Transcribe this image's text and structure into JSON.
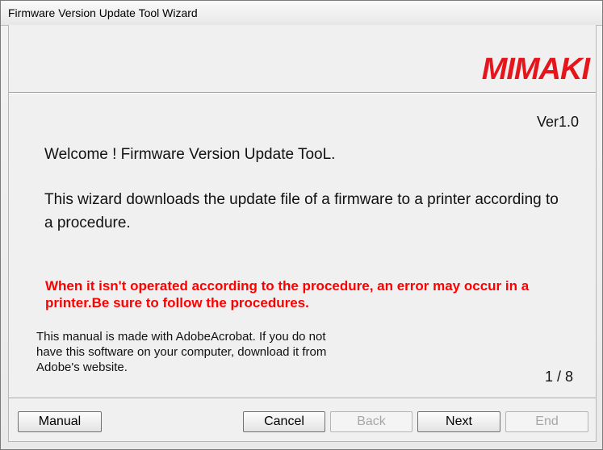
{
  "window": {
    "title": "Firmware Version Update Tool Wizard"
  },
  "brand": {
    "logo_text": "Mimaki",
    "color": "#e6141b"
  },
  "content": {
    "version": "Ver1.0",
    "welcome": "Welcome !  Firmware Version Update TooL.",
    "description": "This wizard downloads the update file of a firmware to a printer according to a procedure.",
    "warning": "When it isn't operated according to the procedure, an error may occur in a printer.Be sure to follow the procedures.",
    "warning_color": "#ff0000",
    "manual_note": "This manual is made with AdobeAcrobat. If you do not have this software on your computer, download it from Adobe's website.",
    "page_indicator": "1 / 8"
  },
  "buttons": {
    "manual": "Manual",
    "cancel": "Cancel",
    "back": "Back",
    "next": "Next",
    "end": "End"
  }
}
